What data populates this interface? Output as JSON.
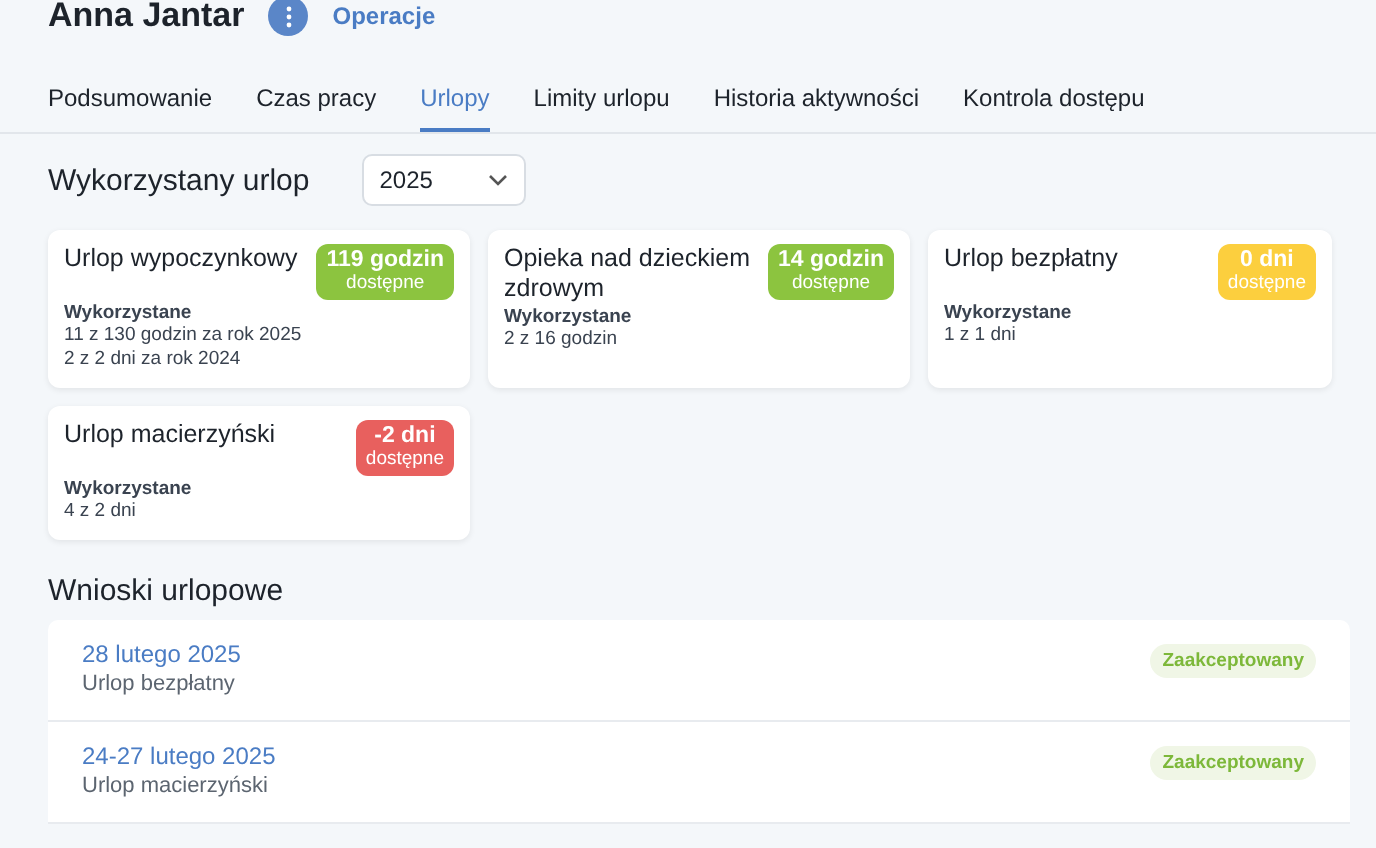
{
  "header": {
    "name": "Anna Jantar",
    "action": "Operacje"
  },
  "tabs": [
    {
      "label": "Podsumowanie",
      "selected": false
    },
    {
      "label": "Czas pracy",
      "selected": false
    },
    {
      "label": "Urlopy",
      "selected": true
    },
    {
      "label": "Limity urlopu",
      "selected": false
    },
    {
      "label": "Historia aktywności",
      "selected": false
    },
    {
      "label": "Kontrola dostępu",
      "selected": false
    }
  ],
  "used_section": {
    "title": "Wykorzystany urlop",
    "year": "2025"
  },
  "cards": [
    {
      "title": "Urlop wypoczynkowy",
      "amount": "119 godzin",
      "amount_label": "dostępne",
      "color": "#8cc43f",
      "used_label": "Wykorzystane",
      "lines": [
        "11 z 130 godzin za rok 2025",
        "2 z 2 dni za rok 2024"
      ]
    },
    {
      "title": "Opieka nad dzieckiem zdrowym",
      "amount": "14 godzin",
      "amount_label": "dostępne",
      "color": "#8cc43f",
      "used_label": "Wykorzystane",
      "lines": [
        "2 z 16 godzin"
      ]
    },
    {
      "title": "Urlop bezpłatny",
      "amount": "0 dni",
      "amount_label": "dostępne",
      "color": "#fccf3e",
      "used_label": "Wykorzystane",
      "lines": [
        "1 z 1 dni"
      ]
    },
    {
      "title": "Urlop macierzyński",
      "amount": "-2 dni",
      "amount_label": "dostępne",
      "color": "#e8605e",
      "used_label": "Wykorzystane",
      "lines": [
        "4 z 2 dni"
      ]
    }
  ],
  "requests": {
    "title": "Wnioski urlopowe",
    "items": [
      {
        "date": "28 lutego 2025",
        "type": "Urlop bezpłatny",
        "status": "Zaakceptowany"
      },
      {
        "date": "24-27 lutego 2025",
        "type": "Urlop macierzyński",
        "status": "Zaakceptowany"
      }
    ]
  }
}
